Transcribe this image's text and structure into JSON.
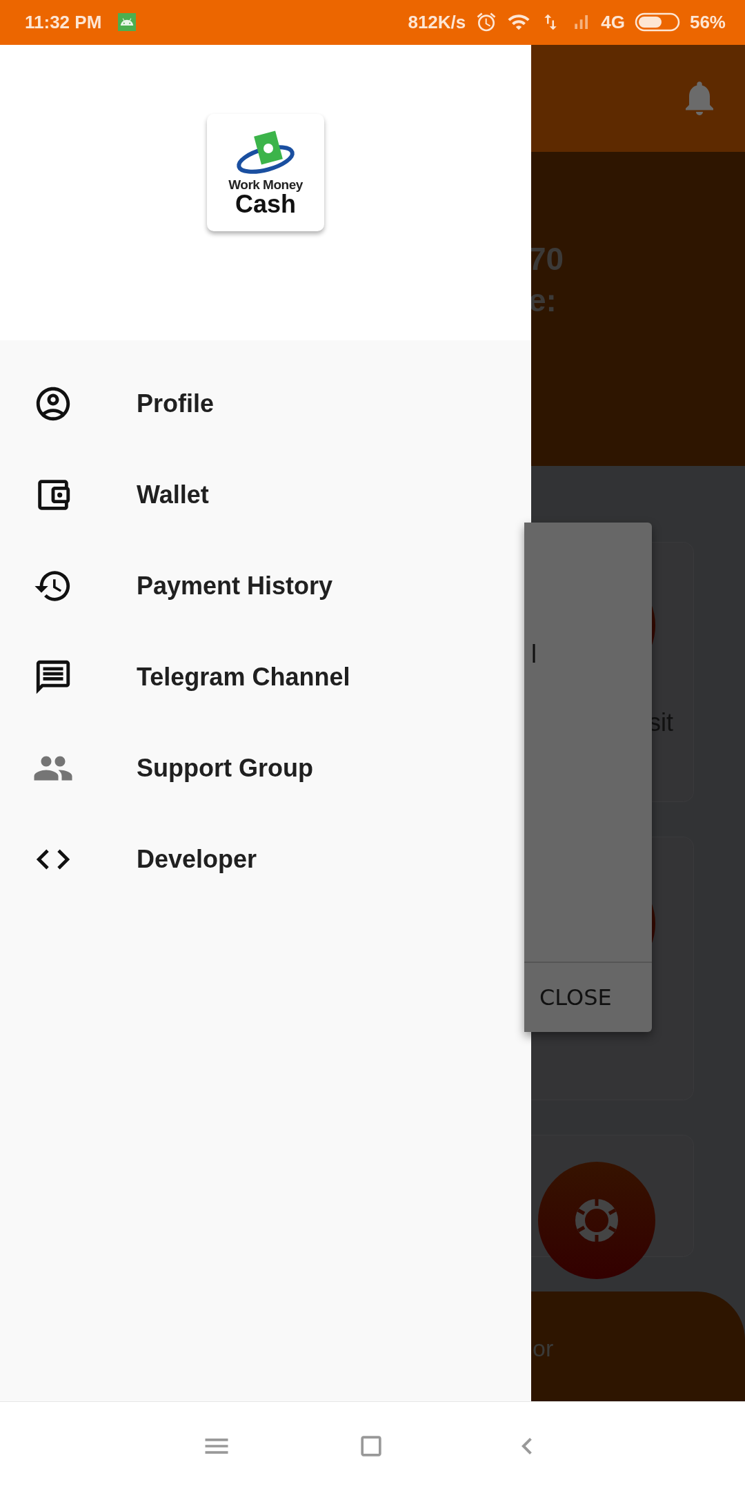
{
  "status_bar": {
    "time": "11:32 PM",
    "speed": "812K/s",
    "network": "4G",
    "battery": "56%"
  },
  "drawer": {
    "logo": {
      "line_1": "Work Money",
      "line_2": "Cash"
    },
    "items": [
      {
        "label": "Profile"
      },
      {
        "label": "Wallet"
      },
      {
        "label": "Payment History"
      },
      {
        "label": "Telegram Channel"
      },
      {
        "label": "Support Group"
      },
      {
        "label": "Developer"
      }
    ]
  },
  "background": {
    "balance_fragment": "70",
    "label_fragment": "e:",
    "card_fragment": "sit",
    "footer_fragment": "or"
  },
  "dialog": {
    "text_fragment": "l",
    "close_button": "CLOSE"
  }
}
